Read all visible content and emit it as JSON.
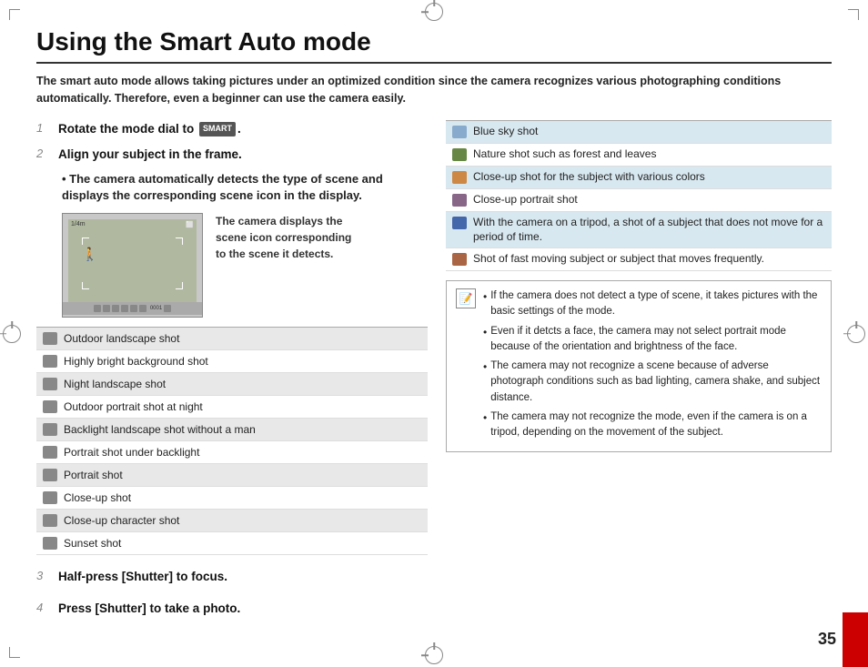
{
  "page": {
    "title": "Using the Smart Auto mode",
    "intro": "The smart auto mode allows taking pictures under an optimized condition since the camera recognizes various photographing conditions automatically. Therefore, even a beginner can use the camera easily.",
    "page_number": "35"
  },
  "steps": {
    "step1_num": "1",
    "step1_text": "Rotate the mode dial to",
    "step1_icon": "SMART",
    "step2_num": "2",
    "step2_text": "Align your subject in the frame.",
    "bullet1": "The camera automatically detects the type of scene and displays the corresponding scene icon in the display.",
    "caption": "The camera displays the scene icon corresponding to the scene it detects.",
    "step3_num": "3",
    "step3_text": "Half-press [Shutter] to focus.",
    "step4_num": "4",
    "step4_text": "Press [Shutter] to take a photo."
  },
  "left_scenes": [
    {
      "icon": "🌄",
      "label": "Outdoor landscape shot",
      "shaded": true
    },
    {
      "icon": "🖵",
      "label": "Highly bright background shot",
      "shaded": false
    },
    {
      "icon": "🌙",
      "label": "Night landscape shot",
      "shaded": true
    },
    {
      "icon": "👤",
      "label": "Outdoor portrait shot at night",
      "shaded": false
    },
    {
      "icon": "🏔",
      "label": "Backlight landscape shot without a man",
      "shaded": true
    },
    {
      "icon": "👤",
      "label": "Portrait shot under backlight",
      "shaded": false
    },
    {
      "icon": "👤",
      "label": "Portrait shot",
      "shaded": true
    },
    {
      "icon": "🔍",
      "label": "Close-up shot",
      "shaded": false
    },
    {
      "icon": "🔍",
      "label": "Close-up character shot",
      "shaded": true
    },
    {
      "icon": "🌅",
      "label": "Sunset shot",
      "shaded": false
    }
  ],
  "right_scenes": [
    {
      "icon": "☁",
      "label": "Blue sky shot",
      "shaded": true
    },
    {
      "icon": "🌿",
      "label": "Nature shot such as forest and leaves",
      "shaded": false
    },
    {
      "icon": "🎨",
      "label": "Close-up shot for the subject with various colors",
      "shaded": true
    },
    {
      "icon": "👤",
      "label": "Close-up portrait shot",
      "shaded": false
    },
    {
      "icon": "📷",
      "label": "With the camera on a tripod, a shot of a subject that does not move for a period of time.",
      "shaded": true
    },
    {
      "icon": "💨",
      "label": "Shot of fast moving subject or subject that moves frequently.",
      "shaded": false
    }
  ],
  "notes": [
    "If the camera does not detect a type of scene, it takes pictures with the basic settings of the mode.",
    "Even if it detcts a face, the camera may not select portrait mode because of the orientation and brightness of the face.",
    "The camera may not recognize a scene because of adverse photograph conditions such as bad lighting, camera shake, and subject distance.",
    "The camera may not recognize the mode, even if the camera is on a tripod, depending on the movement of the subject."
  ]
}
